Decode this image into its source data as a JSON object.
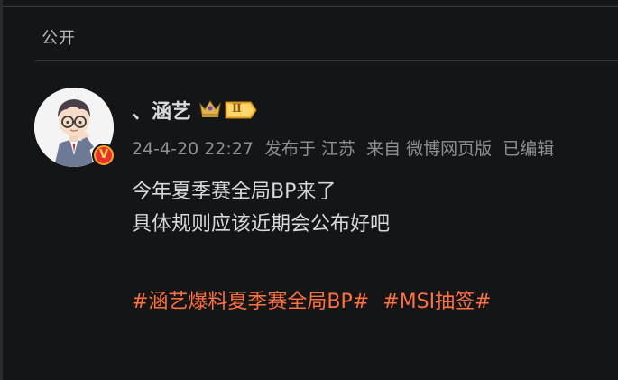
{
  "post": {
    "visibility": "公开",
    "user": {
      "name": "、涵艺",
      "badge_level": "Ⅱ",
      "verified_mark": "V"
    },
    "meta": {
      "time": "24-4-20 22:27",
      "location": "发布于 江苏",
      "source": "来自 微博网页版",
      "edited": "已编辑"
    },
    "content": {
      "line1": "今年夏季赛全局BP来了",
      "line2": "具体规则应该近期会公布好吧"
    },
    "tags": [
      "#涵艺爆料夏季赛全局BP#",
      "#MSI抽签#"
    ]
  },
  "colors": {
    "background": "#141517",
    "text": "#d8d9db",
    "meta": "#8e9093",
    "tag": "#ff7043",
    "badge_gold": "#f5b32f",
    "verified_red": "#e8312f"
  },
  "icons": {
    "crown": "crown-icon",
    "level": "level-badge-icon",
    "verified": "verified-v-icon"
  }
}
